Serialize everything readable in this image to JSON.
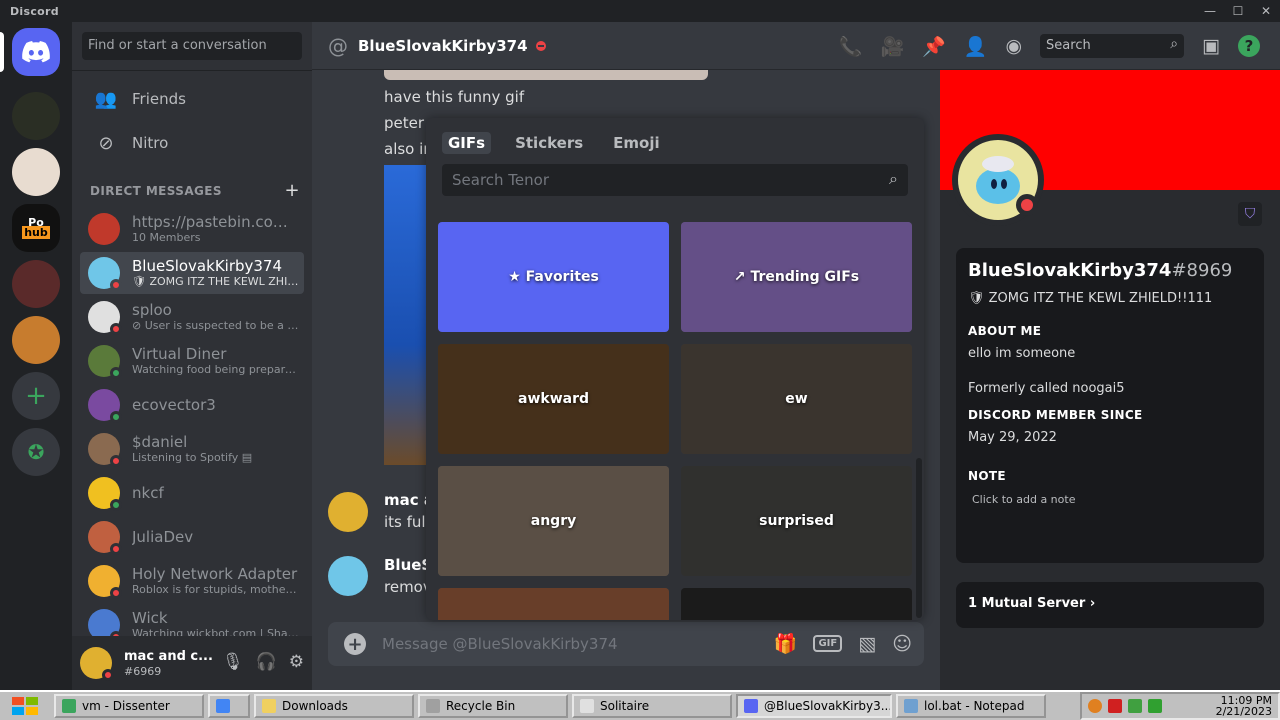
{
  "window": {
    "app_name": "Discord",
    "controls": [
      "—",
      "☐",
      "✕"
    ]
  },
  "servers": [
    {
      "name": "Home",
      "color": "#5865f2"
    },
    {
      "name": "server-dark",
      "color": "#2a2e24"
    },
    {
      "name": "server-family-guy",
      "color": "#e8dcd0"
    },
    {
      "name": "server-orange",
      "color": "#111111"
    },
    {
      "name": "server-portrait",
      "color": "#5a2a2a"
    },
    {
      "name": "server-burger",
      "color": "#c77c2e"
    }
  ],
  "sidebar": {
    "search_placeholder": "Find or start a conversation",
    "nav": [
      {
        "label": "Friends",
        "icon": "friends-icon"
      },
      {
        "label": "Nitro",
        "icon": "nitro-icon"
      }
    ],
    "dm_header": "DIRECT MESSAGES",
    "dms": [
      {
        "name": "https://pastebin.com/...",
        "sub": "10 Members",
        "color": "#c0392b",
        "status": ""
      },
      {
        "name": "BlueSlovakKirby374",
        "sub": "🛡 ZOMG ITZ THE KEWL ZHIE...",
        "color": "#6fc6e8",
        "status": "#ed4245"
      },
      {
        "name": "sploo",
        "sub": "⊘ User is suspected to be a tr...",
        "color": "#e0e0e0",
        "status": "#ed4245"
      },
      {
        "name": "Virtual Diner",
        "sub": "Watching food being prepared!",
        "color": "#5a7a3a",
        "status": "#3ba55d"
      },
      {
        "name": "ecovector3",
        "sub": "",
        "color": "#7a4aa0",
        "status": "#3ba55d"
      },
      {
        "name": "$daniel",
        "sub": "Listening to Spotify ▤",
        "color": "#8a6a50",
        "status": "#ed4245"
      },
      {
        "name": "nkcf",
        "sub": "",
        "color": "#f0c020",
        "status": "#3ba55d"
      },
      {
        "name": "JuliaDev",
        "sub": "",
        "color": "#c06040",
        "status": "#ed4245"
      },
      {
        "name": "Holy Network Adapter",
        "sub": "Roblox is for stupids, motherf...",
        "color": "#f0b030",
        "status": "#ed4245"
      },
      {
        "name": "Wick",
        "sub": "Watching wickbot.com | Shar...",
        "color": "#4a7ad0",
        "status": "#ed4245"
      }
    ],
    "user": {
      "name": "mac and c...",
      "tag": "#6969",
      "color": "#e0b030"
    }
  },
  "header": {
    "title": "BlueSlovakKirby374",
    "search_placeholder": "Search"
  },
  "chat": {
    "lines": [
      "have this funny gif",
      "peter",
      "also in"
    ],
    "msgs": [
      {
        "name": "mac a",
        "text": "its full",
        "color": "#e0b030"
      },
      {
        "name": "BlueSl",
        "text": "remov",
        "color": "#6fc6e8"
      }
    ],
    "composer_placeholder": "Message @BlueSlovakKirby374",
    "gif_label": "GIF"
  },
  "picker": {
    "tabs": [
      "GIFs",
      "Stickers",
      "Emoji"
    ],
    "search_placeholder": "Search Tenor",
    "tiles": [
      {
        "label": "Favorites",
        "icon": "★",
        "color": "#5865f2"
      },
      {
        "label": "Trending GIFs",
        "icon": "↗",
        "color": "#9a7ad0"
      },
      {
        "label": "awkward",
        "icon": "",
        "color": "#6a4a2a"
      },
      {
        "label": "ew",
        "icon": "",
        "color": "#5a5048"
      },
      {
        "label": "angry",
        "icon": "",
        "color": "#8a7a6a"
      },
      {
        "label": "surprised",
        "icon": "",
        "color": "#4a4a48"
      },
      {
        "label": "",
        "icon": "",
        "color": "#a06040"
      },
      {
        "label": "",
        "icon": "",
        "color": "#2a2a2a"
      }
    ]
  },
  "profile": {
    "name": "BlueSlovakKirby374",
    "discriminator": "#8969",
    "status": "🛡 ZOMG ITZ THE KEWL ZHIELD!!111",
    "about_header": "ABOUT ME",
    "about_lines": [
      "ello im someone",
      "Formerly called noogai5"
    ],
    "member_since_header": "DISCORD MEMBER SINCE",
    "member_since": "May 29, 2022",
    "note_header": "NOTE",
    "note_placeholder": "Click to add a note",
    "mutual": "1 Mutual Server",
    "banner_color": "#ff0000"
  },
  "taskbar": {
    "items": [
      {
        "label": "vm - Dissenter",
        "color": "#3ba55d",
        "width": 150
      },
      {
        "label": "",
        "color": "#4285f4",
        "width": 42
      },
      {
        "label": "Downloads",
        "color": "#f0d060",
        "width": 160
      },
      {
        "label": "Recycle Bin",
        "color": "#a0a0a0",
        "width": 150
      },
      {
        "label": "Solitaire",
        "color": "#e0e0e0",
        "width": 160
      },
      {
        "label": "@BlueSlovakKirby3...",
        "color": "#5865f2",
        "width": 156
      },
      {
        "label": "lol.bat - Notepad",
        "color": "#6fa0d0",
        "width": 150
      }
    ],
    "active_index": 5,
    "time": "11:09 PM",
    "date": "2/21/2023"
  }
}
